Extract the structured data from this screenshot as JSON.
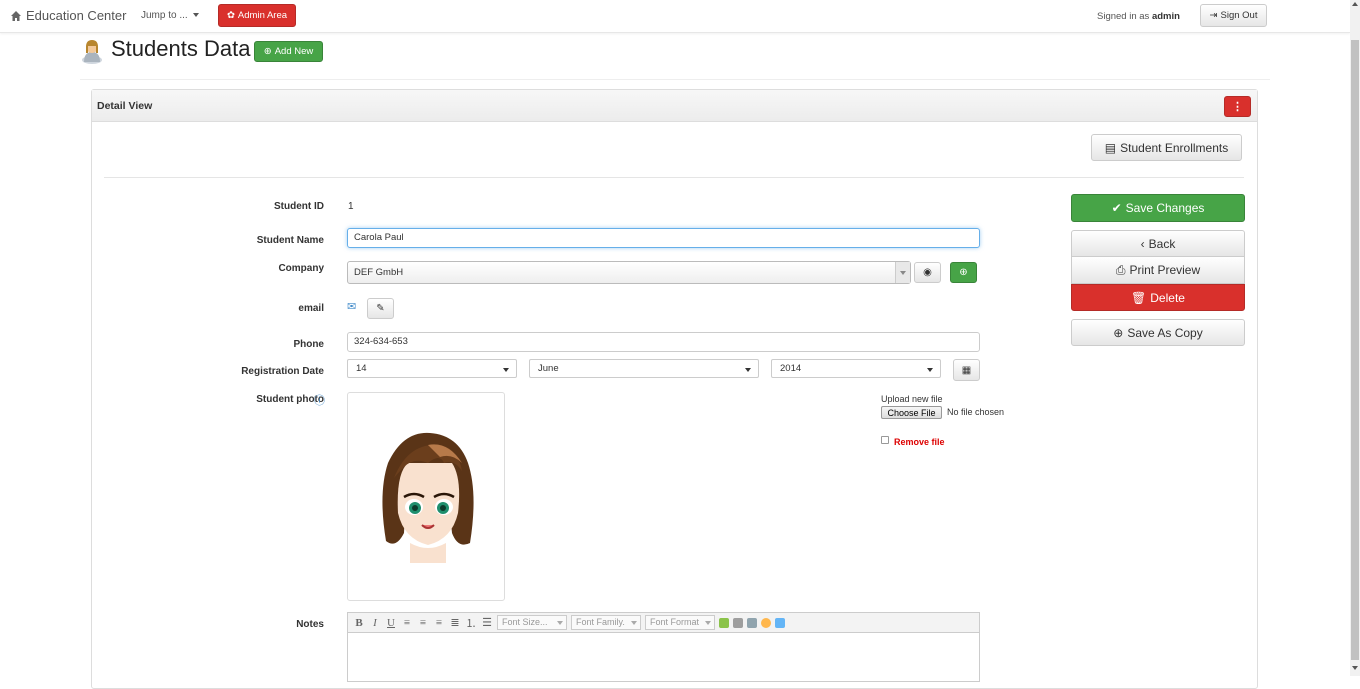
{
  "navbar": {
    "brand": "Education Center",
    "jump_to": "Jump to ...",
    "admin_area": "Admin Area",
    "signed_in_prefix": "Signed in as",
    "username": "admin",
    "sign_out": "Sign Out"
  },
  "page": {
    "title": "Students Data",
    "add_new": "Add New"
  },
  "panel": {
    "title": "Detail View",
    "student_enrollments": "Student Enrollments"
  },
  "form": {
    "student_id_label": "Student ID",
    "student_id_value": "1",
    "student_name_label": "Student Name",
    "student_name_value": "Carola Paul",
    "company_label": "Company",
    "company_value": "DEF GmbH",
    "email_label": "email",
    "phone_label": "Phone",
    "phone_value": "324-634-653",
    "registration_label": "Registration Date",
    "reg_day": "14",
    "reg_month": "June",
    "reg_year": "2014",
    "photo_label": "Student photo",
    "upload_label": "Upload new file",
    "choose_file": "Choose File",
    "no_file": "No file chosen",
    "remove_file": "Remove file",
    "notes_label": "Notes"
  },
  "editor": {
    "font_size": "Font Size...",
    "font_family": "Font Family.",
    "font_format": "Font Format"
  },
  "actions": {
    "save_changes": "Save Changes",
    "back": "Back",
    "print_preview": "Print Preview",
    "delete": "Delete",
    "save_as_copy": "Save As Copy"
  },
  "colors": {
    "success": "#47a447",
    "danger": "#d9302c",
    "link_blue": "#428bca"
  }
}
